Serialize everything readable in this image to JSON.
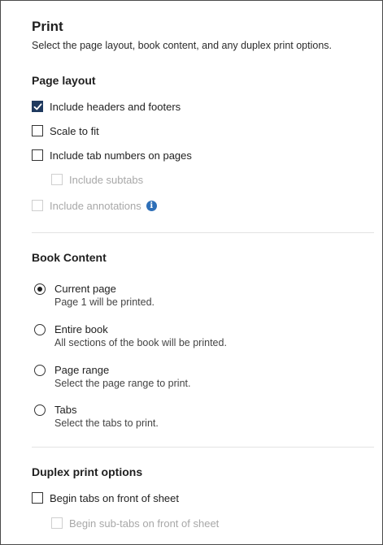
{
  "header": {
    "title": "Print",
    "subtitle": "Select the page layout, book content, and any duplex print options."
  },
  "page_layout": {
    "title": "Page layout",
    "options": [
      {
        "label": "Include headers and footers",
        "checked": true,
        "disabled": false
      },
      {
        "label": "Scale to fit",
        "checked": false,
        "disabled": false
      },
      {
        "label": "Include tab numbers on pages",
        "checked": false,
        "disabled": false
      },
      {
        "label": "Include subtabs",
        "checked": false,
        "disabled": true
      },
      {
        "label": "Include annotations",
        "checked": false,
        "disabled": true
      }
    ]
  },
  "book_content": {
    "title": "Book Content",
    "options": [
      {
        "label": "Current page",
        "description": "Page 1 will be printed.",
        "selected": true
      },
      {
        "label": "Entire book",
        "description": "All sections of the book will be printed.",
        "selected": false
      },
      {
        "label": "Page range",
        "description": "Select the page range to print.",
        "selected": false
      },
      {
        "label": "Tabs",
        "description": "Select the tabs to print.",
        "selected": false
      }
    ]
  },
  "duplex": {
    "title": "Duplex print options",
    "options": [
      {
        "label": "Begin tabs on front of sheet",
        "checked": false,
        "disabled": false
      },
      {
        "label": "Begin sub-tabs on front of sheet",
        "checked": false,
        "disabled": true
      }
    ]
  },
  "colors": {
    "checkbox_checked": "#1f3a5f",
    "info_icon": "#2e6fb8",
    "disabled_text": "#a8a8a8"
  },
  "icons": {
    "info": "info-icon",
    "check": "checkmark-icon"
  }
}
